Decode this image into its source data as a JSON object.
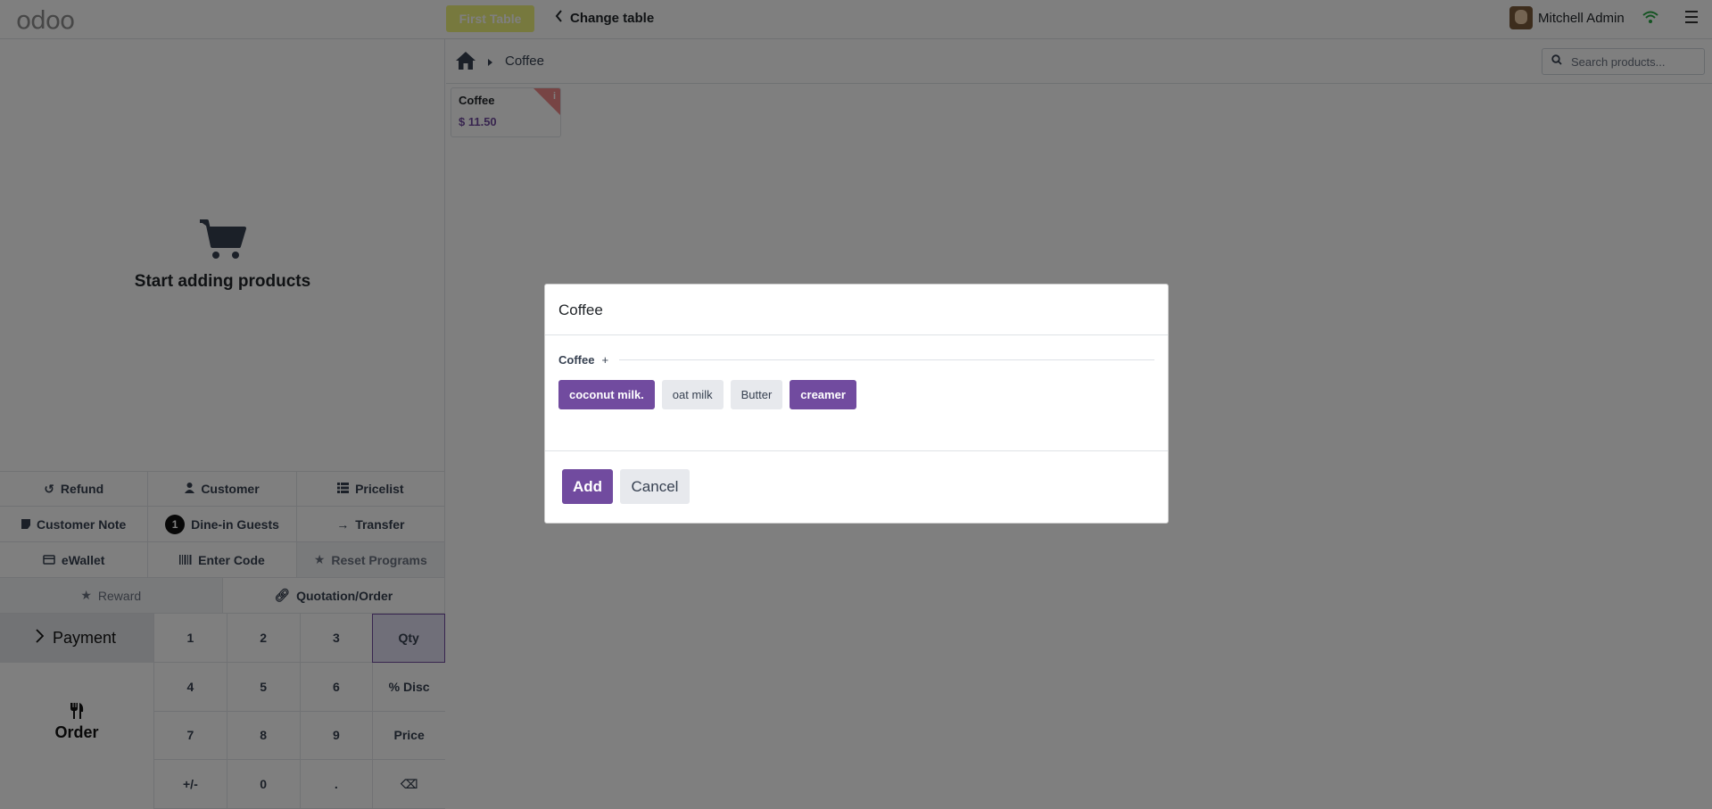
{
  "topbar": {
    "logo": "odoo",
    "table_badge": "First Table",
    "change_table": "Change table",
    "user_name": "Mitchell Admin"
  },
  "cart": {
    "empty_text": "Start adding products"
  },
  "controls": {
    "row1": [
      "Refund",
      "Customer",
      "Pricelist"
    ],
    "row2": [
      "Customer Note",
      "Dine-in Guests",
      "Transfer"
    ],
    "guest_count": "1",
    "row3": [
      "eWallet",
      "Enter Code",
      "Reset Programs"
    ],
    "row4": [
      "Reward",
      "Quotation/Order"
    ]
  },
  "numpad": {
    "payment_label": "Payment",
    "order_label": "Order",
    "keys": [
      "1",
      "2",
      "3",
      "Qty",
      "4",
      "5",
      "6",
      "% Disc",
      "7",
      "8",
      "9",
      "Price",
      "+/-",
      "0",
      ".",
      "⌫"
    ]
  },
  "products": {
    "breadcrumb": "Coffee",
    "search_placeholder": "Search products...",
    "items": [
      {
        "name": "Coffee",
        "price": "$ 11.50"
      }
    ]
  },
  "modal": {
    "title": "Coffee",
    "attribute_label": "Coffee",
    "attribute_plus": "+",
    "options": [
      {
        "label": "coconut milk.",
        "selected": true
      },
      {
        "label": "oat milk",
        "selected": false
      },
      {
        "label": "Butter",
        "selected": false
      },
      {
        "label": "creamer",
        "selected": true
      }
    ],
    "add_label": "Add",
    "cancel_label": "Cancel"
  },
  "colors": {
    "accent": "#714b9f",
    "badge": "#eef37d",
    "wifi": "#28a745"
  }
}
